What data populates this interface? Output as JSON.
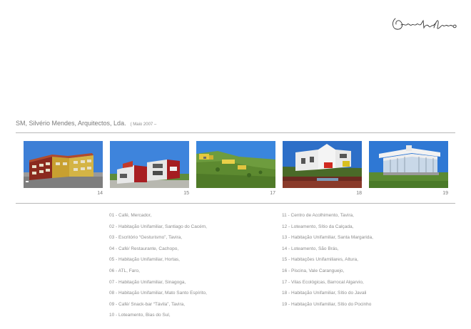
{
  "header": {
    "title": "SM, Silvério Mendes, Arquitectos, Lda.",
    "date": "( Maio 2007 –"
  },
  "gallery": [
    {
      "number": "14"
    },
    {
      "number": "15"
    },
    {
      "number": "17"
    },
    {
      "number": "18"
    },
    {
      "number": "19"
    }
  ],
  "projects_left": [
    "01 - Café, Mercador,",
    "02 - Habitação Unifamiliar, Santiago do Cacém,",
    "03 - Escritório “Gesturismo”, Tavira,",
    "04 - Café/ Restaurante, Cachopo,",
    "05 - Habitação Unifamiliar, Hortas,",
    "06 - ATL, Faro,",
    "07 - Habitação Unifamiliar, Sinagoga,",
    "08 - Habitação Unifamiliar, Mato Santo Espírito,",
    "09 - Café/ Snack-bar “Távila”, Tavira,",
    "10 - Loteamento, Bias do Sul,"
  ],
  "projects_right": [
    "11 - Centro de Acolhimento, Tavira,",
    "12 - Loteamento, Sítio da Calçada,",
    "13 - Habitação Unifamiliar, Santa Margarida,",
    "14 - Loteamento, São Brás,",
    "15 - Habitações Unifamiliares, Altura,",
    "16 - Piscina, Vale Caranguejo,",
    "17 - Vilas Ecológicas, Barrocal Algarvio,",
    "18 - Habitação Unifamiliar, Sítio do Javali",
    "19 - Habitação Unifamiliar, Sítio do Pocinho"
  ]
}
